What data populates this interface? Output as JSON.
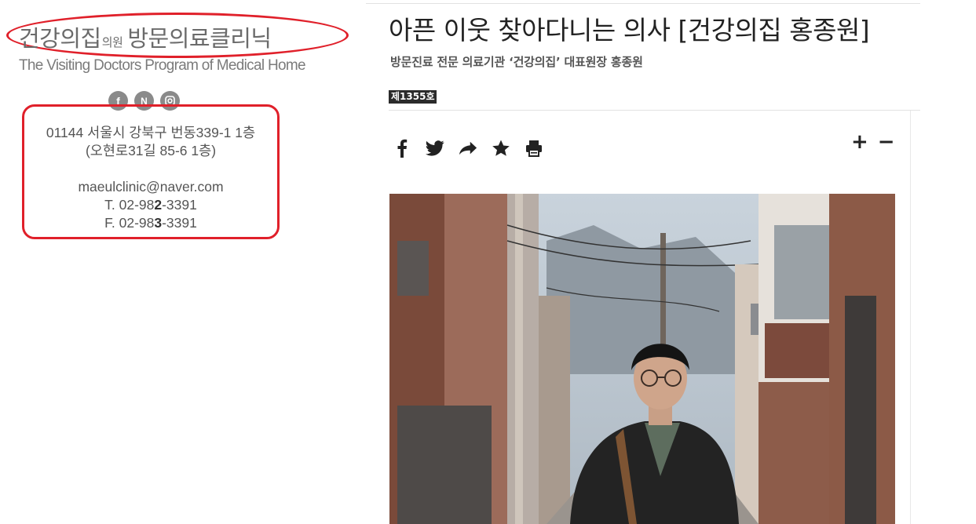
{
  "sidebar": {
    "logo_main": "건강의집",
    "logo_small": "의원",
    "logo_tail": "방문의료클리닉",
    "tagline": "The Visiting Doctors Program of Medical Home",
    "social": [
      {
        "icon": "facebook-icon",
        "glyph": "f"
      },
      {
        "icon": "naver-icon",
        "glyph": "N"
      },
      {
        "icon": "instagram-icon",
        "glyph": "◙"
      }
    ],
    "contact": {
      "address1": "01144 서울시 강북구 번동339-1 1층",
      "address2": "(오현로31길 85-6  1층)",
      "email": "maeulclinic@naver.com",
      "tel_prefix": "T. 02-98",
      "tel_bold": "2",
      "tel_suffix": "-3391",
      "fax_prefix": "F. 02-98",
      "fax_bold": "3",
      "fax_suffix": "-3391"
    },
    "highlight_color": "#e0202a"
  },
  "article": {
    "headline": "아픈 이웃 찾아다니는 의사 [건강의집 홍종원]",
    "subhead": "방문진료 전문 의료기관 ‘건강의집’ 대표원장 홍종원",
    "issue": "제1355호",
    "share_icons": [
      "facebook-icon",
      "twitter-icon",
      "share-icon",
      "bookmark-star-icon",
      "print-icon"
    ],
    "font_increase": "+",
    "font_decrease": "−"
  }
}
